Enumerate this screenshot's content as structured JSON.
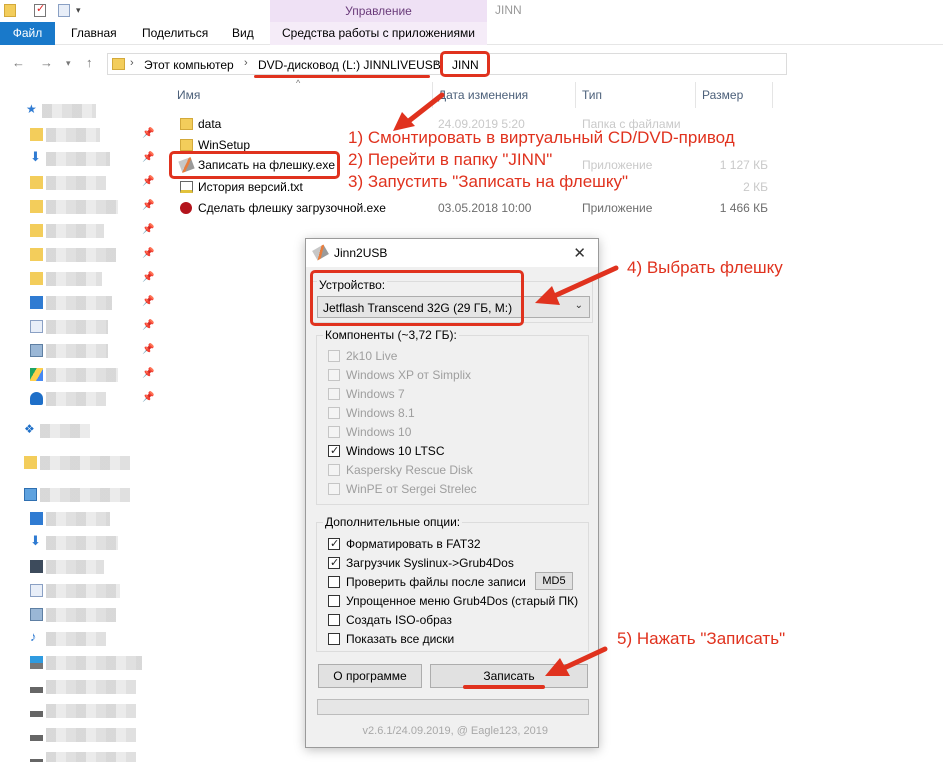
{
  "window": {
    "title": "JINN",
    "manage_tab": "Управление"
  },
  "ribbon": {
    "tabs": [
      "Файл",
      "Главная",
      "Поделиться",
      "Вид",
      "Средства работы с приложениями"
    ]
  },
  "address": {
    "crumbs": [
      "Этот компьютер",
      "DVD-дисковод (L:) JINNLIVEUSB",
      "JINN"
    ]
  },
  "columns": [
    "Имя",
    "Дата изменения",
    "Тип",
    "Размер"
  ],
  "files": [
    {
      "name": "data",
      "date": "24.09.2019 5:20",
      "type": "Папка с файлами",
      "size": "",
      "icon": "folder-icon"
    },
    {
      "name": "WinSetup",
      "date": "",
      "type": "",
      "size": "",
      "icon": "folder-icon"
    },
    {
      "name": "Записать на флешку.exe",
      "date": "",
      "type": "Приложение",
      "size": "1 127 КБ",
      "icon": "usb-stick-icon"
    },
    {
      "name": "История версий.txt",
      "date": "",
      "type": "",
      "size": "2 КБ",
      "icon": "text-file-icon"
    },
    {
      "name": "Сделать флешку загрузочной.exe",
      "date": "03.05.2018 10:00",
      "type": "Приложение",
      "size": "1 466 КБ",
      "icon": "red-ball-icon"
    }
  ],
  "dialog": {
    "title": "Jinn2USB",
    "device_label": "Устройство:",
    "device_value": "Jetflash Transcend 32G (29 ГБ, M:)",
    "components_label": "Компоненты (~3,72 ГБ):",
    "components": [
      {
        "label": "2k10 Live",
        "checked": false
      },
      {
        "label": "Windows XP от Simplix",
        "checked": false
      },
      {
        "label": "Windows 7",
        "checked": false
      },
      {
        "label": "Windows 8.1",
        "checked": false
      },
      {
        "label": "Windows 10",
        "checked": false
      },
      {
        "label": "Windows 10 LTSC",
        "checked": true
      },
      {
        "label": "Kaspersky Rescue Disk",
        "checked": false
      },
      {
        "label": "WinPE от Sergei Strelec",
        "checked": false
      }
    ],
    "options_label": "Дополнительные опции:",
    "options": [
      {
        "label": "Форматировать в FAT32",
        "checked": true
      },
      {
        "label": "Загрузчик Syslinux->Grub4Dos",
        "checked": true
      },
      {
        "label": "Проверить файлы после записи",
        "checked": false
      },
      {
        "label": "Упрощенное меню Grub4Dos (старый ПК)",
        "checked": false
      },
      {
        "label": "Создать ISO-образ",
        "checked": false
      },
      {
        "label": "Показать все диски",
        "checked": false
      }
    ],
    "md5_button": "MD5",
    "about_button": "О программе",
    "write_button": "Записать",
    "progress": 0,
    "version": "v2.6.1/24.09.2019, @ Eagle123, 2019"
  },
  "annotations": {
    "step1": "1) Смонтировать в виртуальный CD/DVD-привод",
    "step2": "2) Перейти в папку \"JINN\"",
    "step3": "3) Запустить \"Записать на флешку\"",
    "step4": "4) Выбрать флешку",
    "step5": "5) Нажать \"Записать\"",
    "color": "#e0321e"
  },
  "colors": {
    "file_tab": "#1979ca",
    "manage_tab": "#efe1f5",
    "dialog_bg": "#f0f0f0"
  }
}
